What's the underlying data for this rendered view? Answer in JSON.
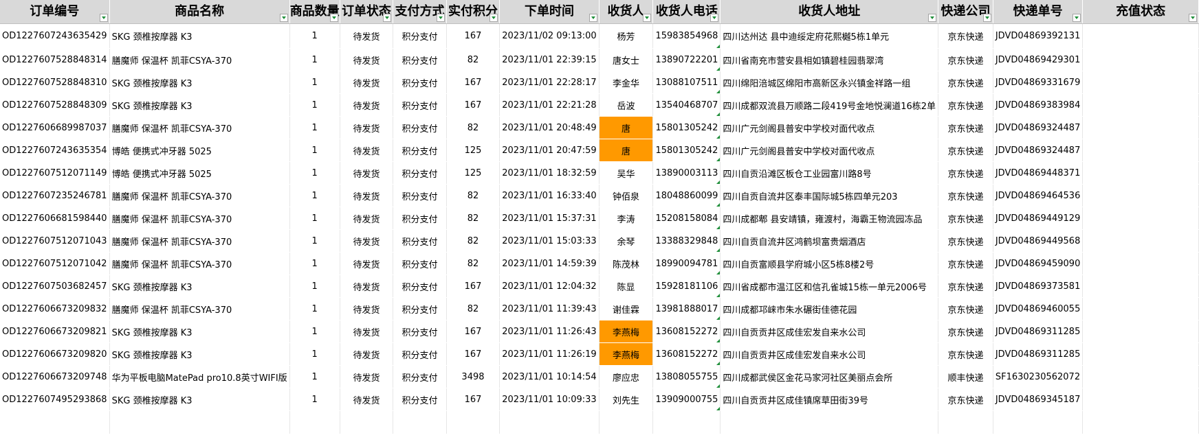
{
  "headers": [
    "订单编号",
    "商品名称",
    "商品数量",
    "订单状态",
    "支付方式",
    "实付积分",
    "下单时间",
    "收货人",
    "收货人电话",
    "收货人地址",
    "快递公司",
    "快递单号",
    "充值状态"
  ],
  "rows": [
    [
      "OD1227607243635429",
      "SKG 颈椎按摩器 K3",
      "1",
      "待发货",
      "积分支付",
      "167",
      "2023/11/02 09:13:00",
      "杨芳",
      "15983854968",
      "四川达州达 县中迪绥定府花熙樾5栋1单元",
      "京东快递",
      "JDVD04869392131",
      ""
    ],
    [
      "OD1227607528848314",
      "膳魔师 保温杯 凯菲CSYA-370",
      "1",
      "待发货",
      "积分支付",
      "82",
      "2023/11/01 22:39:15",
      "唐女士",
      "13890722201",
      "四川省南充市营安县相如镇碧桂园翡翠湾",
      "京东快递",
      "JDVD04869429301",
      ""
    ],
    [
      "OD1227607528848310",
      "SKG 颈椎按摩器 K3",
      "1",
      "待发货",
      "积分支付",
      "167",
      "2023/11/01 22:28:17",
      "李金华",
      "13088107511",
      "四川绵阳涪城区绵阳市高新区永兴镇金祥路一组",
      "京东快递",
      "JDVD04869331679",
      ""
    ],
    [
      "OD1227607528848309",
      "SKG 颈椎按摩器 K3",
      "1",
      "待发货",
      "积分支付",
      "167",
      "2023/11/01 22:21:28",
      "岳波",
      "13540468707",
      "四川成都双流县万顺路二段419号金地悦澜道16栋2单",
      "京东快递",
      "JDVD04869383984",
      ""
    ],
    [
      "OD1227606689987037",
      "膳魔师 保温杯 凯菲CSYA-370",
      "1",
      "待发货",
      "积分支付",
      "82",
      "2023/11/01 20:48:49",
      "唐",
      "15801305242",
      "四川广元剑阁县普安中学校对面代收点",
      "京东快递",
      "JDVD04869324487",
      ""
    ],
    [
      "OD1227607243635354",
      "博皓 便携式冲牙器 5025",
      "1",
      "待发货",
      "积分支付",
      "125",
      "2023/11/01 20:47:59",
      "唐",
      "15801305242",
      "四川广元剑阁县普安中学校对面代收点",
      "京东快递",
      "JDVD04869324487",
      ""
    ],
    [
      "OD1227607512071149",
      "博皓 便携式冲牙器 5025",
      "1",
      "待发货",
      "积分支付",
      "125",
      "2023/11/01 18:32:59",
      "吴华",
      "13890003113",
      "四川自贡沿滩区板仓工业园富川路8号",
      "京东快递",
      "JDVD04869448371",
      ""
    ],
    [
      "OD1227607235246781",
      "膳魔师 保温杯 凯菲CSYA-370",
      "1",
      "待发货",
      "积分支付",
      "82",
      "2023/11/01 16:33:40",
      "钟佰泉",
      "18048860099",
      "四川自贡自流井区泰丰国际城5栋四单元203",
      "京东快递",
      "JDVD04869464536",
      ""
    ],
    [
      "OD1227606681598440",
      "膳魔师 保温杯 凯菲CSYA-370",
      "1",
      "待发货",
      "积分支付",
      "82",
      "2023/11/01 15:37:31",
      "李涛",
      "15208158084",
      "四川成都郫 县安靖镇，雍渡村，海霸王物流园冻品",
      "京东快递",
      "JDVD04869449129",
      ""
    ],
    [
      "OD1227607512071043",
      "膳魔师 保温杯 凯菲CSYA-370",
      "1",
      "待发货",
      "积分支付",
      "82",
      "2023/11/01 15:03:33",
      "余琴",
      "13388329848",
      "四川自贡自流井区鸿鹤坝富贵烟酒店",
      "京东快递",
      "JDVD04869449568",
      ""
    ],
    [
      "OD1227607512071042",
      "膳魔师 保温杯 凯菲CSYA-370",
      "1",
      "待发货",
      "积分支付",
      "82",
      "2023/11/01 14:59:39",
      "陈茂林",
      "18990094781",
      "四川自贡富顺县学府城小区5栋8楼2号",
      "京东快递",
      "JDVD04869459090",
      ""
    ],
    [
      "OD1227607503682457",
      "SKG 颈椎按摩器 K3",
      "1",
      "待发货",
      "积分支付",
      "167",
      "2023/11/01 12:04:32",
      "陈显",
      "15928181106",
      "四川省成都市温江区和信孔雀城15栋一单元2006号",
      "京东快递",
      "JDVD04869373581",
      ""
    ],
    [
      "OD1227606673209832",
      "膳魔师 保温杯 凯菲CSYA-370",
      "1",
      "待发货",
      "积分支付",
      "82",
      "2023/11/01 11:39:43",
      "谢佳霖",
      "13981888017",
      "四川成都邛崃市朱水碾街佳德花园",
      "京东快递",
      "JDVD04869460055",
      ""
    ],
    [
      "OD1227606673209821",
      "SKG 颈椎按摩器 K3",
      "1",
      "待发货",
      "积分支付",
      "167",
      "2023/11/01 11:26:43",
      "李燕梅",
      "13608152272",
      "四川自贡贡井区成佳宏发自来水公司",
      "京东快递",
      "JDVD04869311285",
      ""
    ],
    [
      "OD1227606673209820",
      "SKG 颈椎按摩器 K3",
      "1",
      "待发货",
      "积分支付",
      "167",
      "2023/11/01 11:26:19",
      "李燕梅",
      "13608152272",
      "四川自贡贡井区成佳宏发自来水公司",
      "京东快递",
      "JDVD04869311285",
      ""
    ],
    [
      "OD1227606673209748",
      "华为平板电脑MatePad pro10.8英寸WIFI版",
      "1",
      "待发货",
      "积分支付",
      "3498",
      "2023/11/01 10:14:54",
      "廖应忠",
      "13808055755",
      "四川成都武侯区金花马家河社区美丽点会所",
      "顺丰快递",
      "SF1630230562072",
      ""
    ],
    [
      "OD1227607495293868",
      "SKG 颈椎按摩器 K3",
      "1",
      "待发货",
      "积分支付",
      "167",
      "2023/11/01 10:09:33",
      "刘先生",
      "13909000755",
      "四川自贡贡井区成佳镇席草田街39号",
      "京东快递",
      "JDVD04869345187",
      ""
    ]
  ],
  "highlighted_cells": [
    [
      4,
      7
    ],
    [
      5,
      7
    ],
    [
      13,
      7
    ],
    [
      14,
      7
    ]
  ],
  "highlight_color": "#ff9900"
}
